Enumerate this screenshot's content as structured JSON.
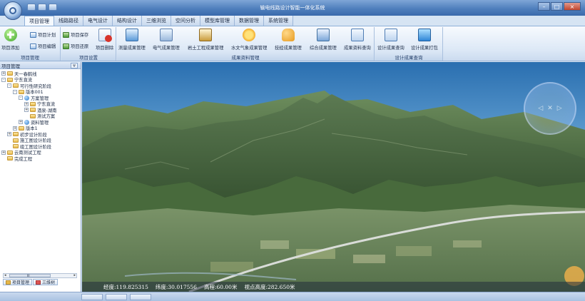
{
  "window": {
    "title": "输电线路设计智能一体化系统",
    "controls": [
      "–",
      "□",
      "×"
    ]
  },
  "tabs": [
    {
      "label": "项目管理",
      "active": true
    },
    {
      "label": "线路路径"
    },
    {
      "label": "电气设计"
    },
    {
      "label": "结构设计"
    },
    {
      "label": "三维浏览"
    },
    {
      "label": "空间分析"
    },
    {
      "label": "模型库管理"
    },
    {
      "label": "数据管理"
    },
    {
      "label": "系统管理"
    }
  ],
  "ribbon": {
    "group_project": {
      "label": "项目管理",
      "add": "项目添加",
      "plan": "项目计划",
      "edit": "项目编辑"
    },
    "group_settings": {
      "label": "项目设置",
      "archive": "项目保存",
      "restore": "项目还原",
      "delete": "项目删除"
    },
    "group_results": {
      "label": "成果资料管理",
      "items": [
        "测量成果管理",
        "电气成果管理",
        "岩土工程成果管理",
        "水文气象成果管理",
        "技经成果管理",
        "综合成果管理",
        "成果资料查询"
      ]
    },
    "group_design": {
      "label": "设计成果查询",
      "items": [
        "设计成果查询",
        "设计成果打包"
      ]
    }
  },
  "sidebar": {
    "title": "项目管理",
    "pin": "ψ",
    "tree": [
      {
        "label": "天一春鹤线",
        "level": 0,
        "exp": "+"
      },
      {
        "label": "宁东直流",
        "level": 0,
        "exp": "-"
      },
      {
        "label": "可行性研究阶段",
        "level": 1,
        "exp": "-"
      },
      {
        "label": "版本001",
        "level": 2,
        "exp": "-"
      },
      {
        "label": "方案管理",
        "level": 3,
        "exp": "-",
        "icon": "globe"
      },
      {
        "label": "宁东直流",
        "level": 4,
        "exp": "+"
      },
      {
        "label": "酒泉-湖南",
        "level": 4,
        "exp": "+"
      },
      {
        "label": "测试方案",
        "level": 4,
        "exp": ""
      },
      {
        "label": "资料管理",
        "level": 3,
        "exp": "+",
        "icon": "globe"
      },
      {
        "label": "版本1",
        "level": 2,
        "exp": "+"
      },
      {
        "label": "初步设计阶段",
        "level": 1,
        "exp": "+"
      },
      {
        "label": "施工图设计阶段",
        "level": 1,
        "exp": ""
      },
      {
        "label": "竣工图设计阶段",
        "level": 1,
        "exp": ""
      },
      {
        "label": "云南测试工程",
        "level": 0,
        "exp": "+"
      },
      {
        "label": "完成工程",
        "level": 0,
        "exp": ""
      }
    ],
    "scroll_left": "◂",
    "scroll_right": "▸",
    "scroll_thumb": "III",
    "bottom_tabs": [
      "项目管理",
      "三维树"
    ]
  },
  "status": {
    "longitude": "经度:119.825315",
    "latitude": "纬度:30.017556",
    "altitude": "高程:60.00米",
    "view_height": "视点高度:282.650米"
  },
  "colors": {
    "ribbon_bg": "#dce8f6",
    "title_bg": "#4f7fbd"
  }
}
